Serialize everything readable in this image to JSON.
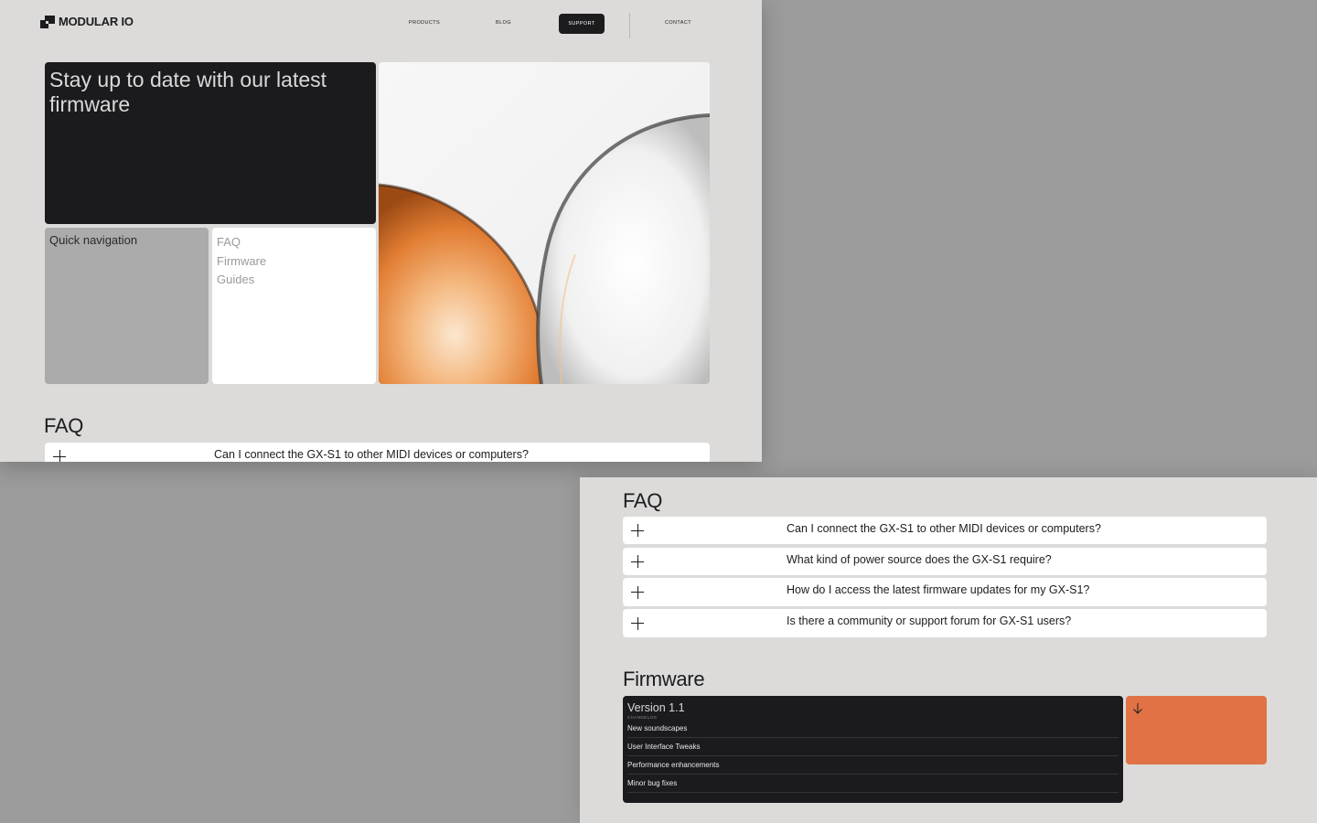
{
  "brand": {
    "name": "MODULAR IO"
  },
  "nav": {
    "products": "PRODUCTS",
    "blog": "BLOG",
    "support": "SUPPORT",
    "contact": "CONTACT"
  },
  "hero": {
    "title": "Stay up to date with our latest firmware"
  },
  "quick_nav": {
    "label": "Quick navigation",
    "links": [
      "FAQ",
      "Firmware",
      "Guides"
    ]
  },
  "faq": {
    "title": "FAQ",
    "questions": [
      "Can I connect the GX-S1 to other MIDI devices or computers?",
      "What kind of power source does the GX-S1 require?",
      "How do I access the latest firmware updates for my GX-S1?",
      "Is there a community or support forum for GX-S1 users?"
    ]
  },
  "firmware": {
    "title": "Firmware",
    "version": "Version 1.1",
    "changelog_label": "CHANGELOG",
    "items": [
      "New soundscapes",
      "User Interface Tweaks",
      "Performance enhancements",
      "Minor bug fixes"
    ],
    "download_icon": "arrow-down-icon"
  },
  "colors": {
    "background": "#9b9b9b",
    "panel": "#dcdbd9",
    "dark": "#1b1b1e",
    "accent": "#e07245"
  }
}
